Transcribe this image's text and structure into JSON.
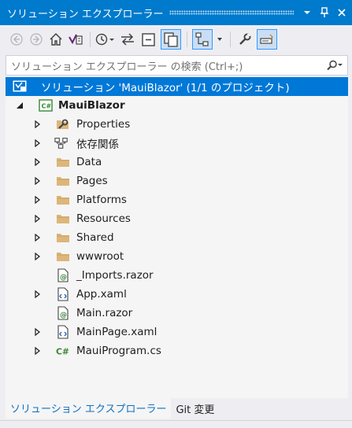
{
  "window": {
    "title": "ソリューション エクスプローラー",
    "dropdown_icon": "chevron-down-icon",
    "pin_icon": "pin-icon",
    "close_icon": "close-icon"
  },
  "toolbar": {
    "buttons": [
      "back-icon",
      "forward-icon",
      "home-icon",
      "vs-switch-views-icon",
      "pending-changes-filter-icon",
      "sync-with-active-document-icon",
      "collapse-all-icon",
      "show-all-files-icon",
      "view-class-diagram-icon",
      "properties-icon",
      "preview-selected-items-icon"
    ]
  },
  "search": {
    "placeholder": "ソリューション エクスプローラー の検索 (Ctrl+;)"
  },
  "tree": {
    "solution": "ソリューション 'MauiBlazor' (1/1 のプロジェクト)",
    "project": "MauiBlazor",
    "items": [
      {
        "label": "Properties",
        "icon": "wrench-folder-icon",
        "expandable": true
      },
      {
        "label": "依存関係",
        "icon": "dependencies-icon",
        "expandable": true
      },
      {
        "label": "Data",
        "icon": "folder-icon",
        "expandable": true
      },
      {
        "label": "Pages",
        "icon": "folder-icon",
        "expandable": true
      },
      {
        "label": "Platforms",
        "icon": "folder-icon",
        "expandable": true
      },
      {
        "label": "Resources",
        "icon": "folder-icon",
        "expandable": true
      },
      {
        "label": "Shared",
        "icon": "folder-icon",
        "expandable": true
      },
      {
        "label": "wwwroot",
        "icon": "folder-icon",
        "expandable": true
      },
      {
        "label": "_Imports.razor",
        "icon": "razor-file-icon",
        "expandable": false
      },
      {
        "label": "App.xaml",
        "icon": "xaml-file-icon",
        "expandable": true
      },
      {
        "label": "Main.razor",
        "icon": "razor-file-icon",
        "expandable": false
      },
      {
        "label": "MainPage.xaml",
        "icon": "xaml-file-icon",
        "expandable": true
      },
      {
        "label": "MauiProgram.cs",
        "icon": "csharp-file-icon",
        "expandable": true
      }
    ]
  },
  "tabs": {
    "solution_explorer": "ソリューション エクスプローラー",
    "git_changes": "Git 変更"
  },
  "colors": {
    "accent": "#007acc",
    "selection": "#0078d7",
    "folder": "#dcb67a",
    "csharp": "#368832"
  }
}
